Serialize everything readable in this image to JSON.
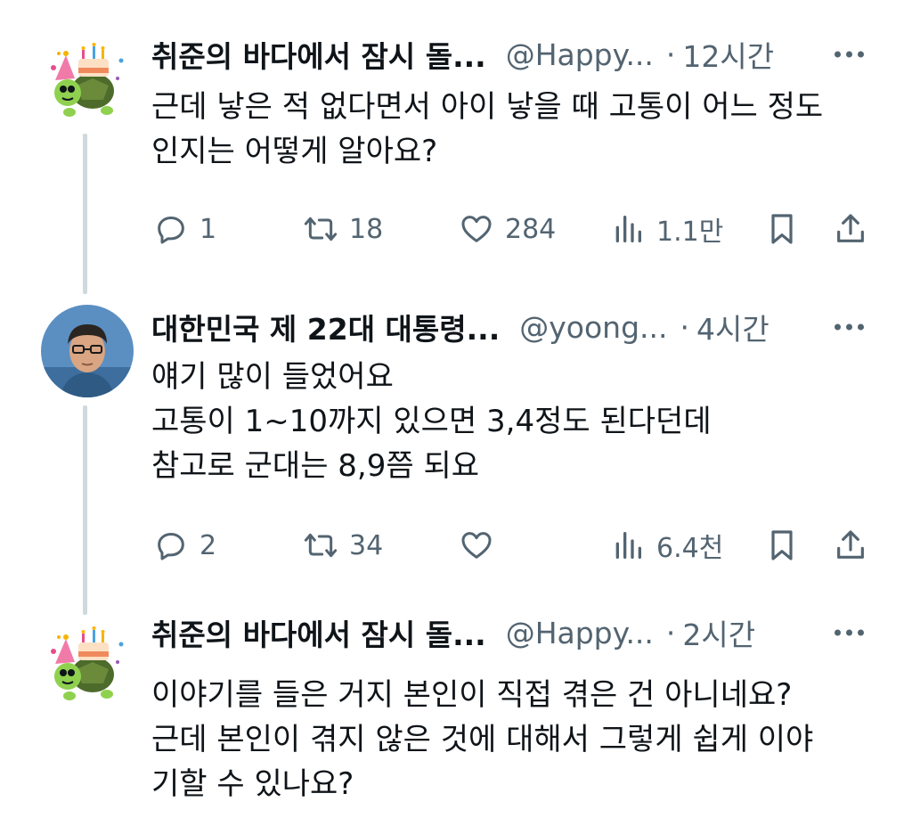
{
  "tweets": [
    {
      "name": "취준의 바다에서 잠시 돌...",
      "handle": "@Happy...",
      "time": "12시간",
      "avatar": "birthday-turtle-avatar",
      "lines": [
        "근데 낳은 적 없다면서 아이 낳을 때 고통이 어느 정도",
        "인지는 어떻게 알아요?"
      ],
      "replies": "1",
      "retweets": "18",
      "likes": "284",
      "views": "1.1만"
    },
    {
      "name": "대한민국 제 22대 대통령...",
      "handle": "@yoong...",
      "time": "4시간",
      "avatar": "man-glasses-avatar",
      "lines": [
        "얘기 많이 들었어요",
        "고통이 1~10까지 있으면 3,4정도 된다던데",
        "참고로 군대는 8,9쯤 되요"
      ],
      "replies": "2",
      "retweets": "34",
      "likes": "",
      "views": "6.4천"
    },
    {
      "name": "취준의 바다에서 잠시 돌...",
      "handle": "@Happy...",
      "time": "2시간",
      "avatar": "birthday-turtle-avatar",
      "lines": [
        "이야기를 들은 거지 본인이 직접 겪은 건 아니네요?",
        "근데 본인이 겪지 않은 것에 대해서 그렇게 쉽게 이야",
        "기할 수 있나요?"
      ]
    }
  ],
  "icons": {
    "reply": "reply-bubble-icon",
    "retweet": "retweet-arrows-icon",
    "like": "heart-icon",
    "views": "views-bar-chart-icon",
    "bookmark": "bookmark-icon",
    "share": "share-upload-icon",
    "more": "more-dots-icon"
  },
  "colors": {
    "text": "#0f1419",
    "secondary": "#536471",
    "thread_line": "#cfd9de",
    "background": "#ffffff"
  }
}
